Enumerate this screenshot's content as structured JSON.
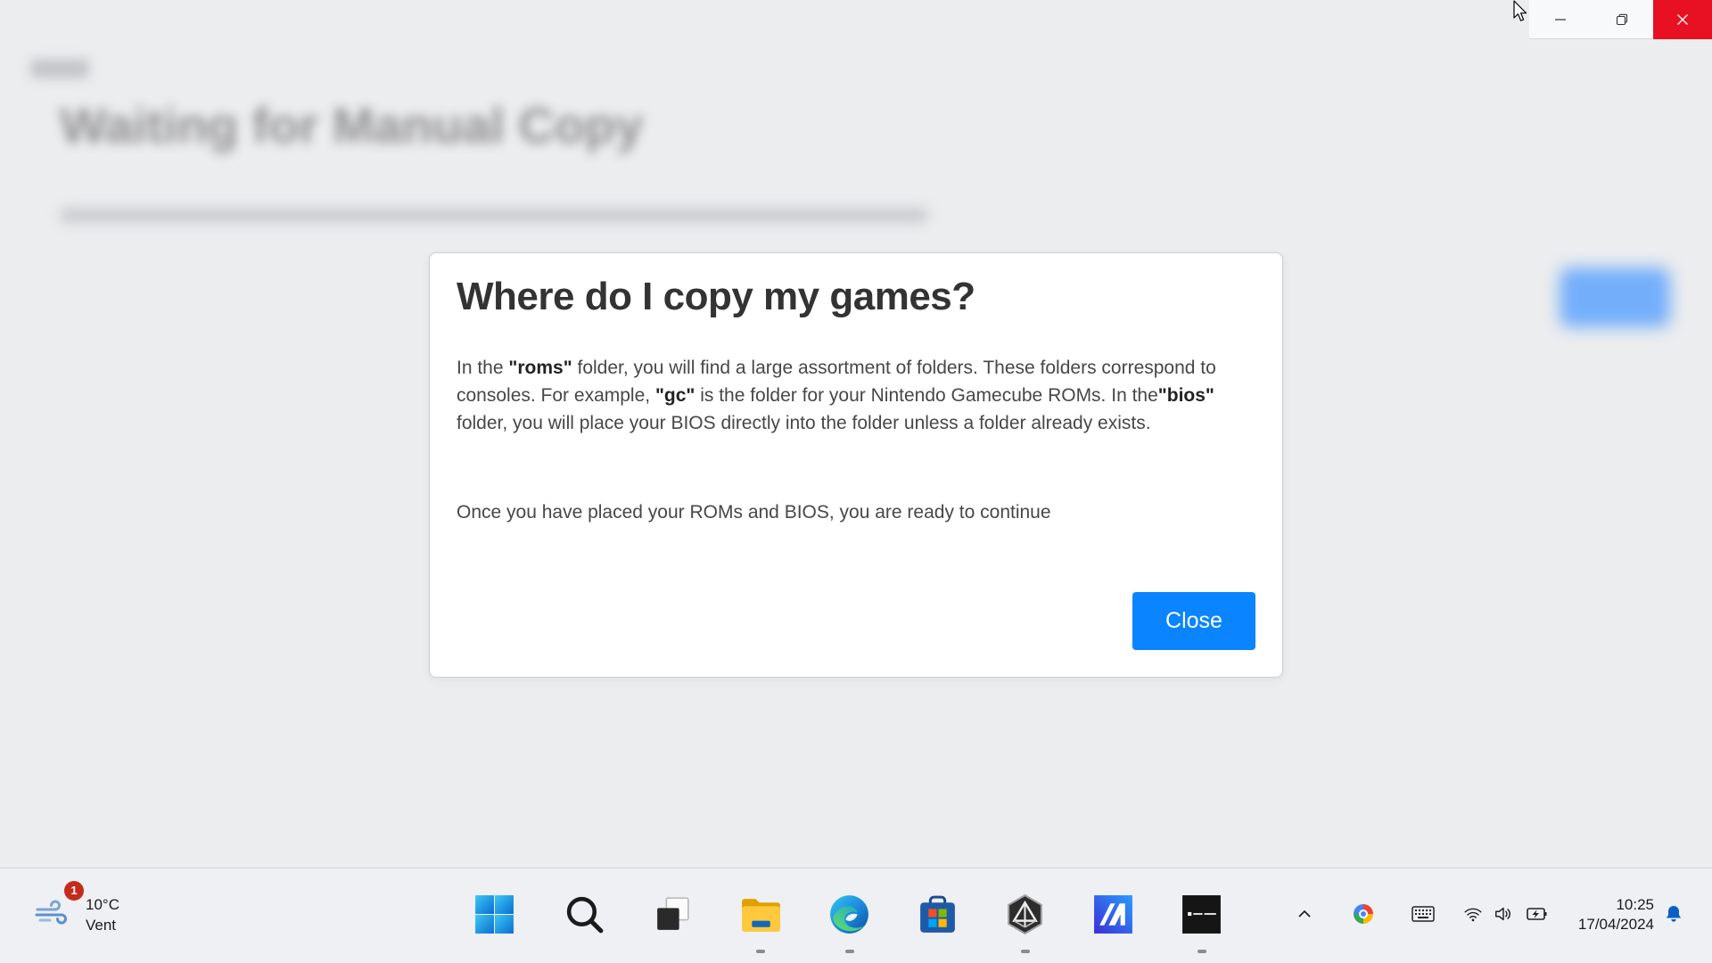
{
  "window_controls": {
    "minimize_icon": "minimize-icon",
    "restore_icon": "restore-icon",
    "close_icon": "close-icon",
    "close_background": "#e81123"
  },
  "background_page": {
    "title": "Waiting for Manual Copy",
    "button_color": "#2f8bff"
  },
  "dialog": {
    "title": "Where do I copy my games?",
    "paragraph1": {
      "t1": "In the ",
      "b1": "\"roms\"",
      "t2": " folder, you will find a large assortment of folders. These folders correspond to consoles. For example, ",
      "b2": "\"gc\"",
      "t3": " is the folder for your Nintendo Gamecube ROMs. In the",
      "b3": "\"bios\"",
      "t4": " folder, you will place your BIOS directly into the folder unless a folder already exists."
    },
    "paragraph2": "Once you have placed your ROMs and BIOS, you are ready to continue",
    "close_label": "Close",
    "button_color": "#0a84ff"
  },
  "taskbar": {
    "weather": {
      "icon": "wind-icon",
      "badge": "1",
      "temperature": "10°C",
      "condition": "Vent"
    },
    "pinned_apps": [
      {
        "icon": "windows-start-icon",
        "running": false
      },
      {
        "icon": "search-icon",
        "running": false
      },
      {
        "icon": "task-view-icon",
        "running": false
      },
      {
        "icon": "file-explorer-icon",
        "running": true
      },
      {
        "icon": "edge-icon",
        "running": true
      },
      {
        "icon": "microsoft-store-icon",
        "running": false
      },
      {
        "icon": "hexagon-app-icon",
        "running": true
      },
      {
        "icon": "blue-app-icon",
        "running": false
      },
      {
        "icon": "emudeck-icon",
        "running": true
      }
    ],
    "tray": {
      "icons": [
        "chevron-up-icon",
        "color-circle-icon",
        "keyboard-icon",
        "wifi-icon",
        "volume-icon",
        "battery-charging-icon",
        "notification-bell-icon"
      ],
      "time": "10:25",
      "date": "17/04/2024"
    }
  }
}
